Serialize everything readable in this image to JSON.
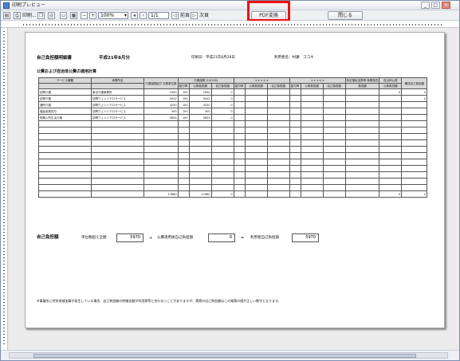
{
  "window": {
    "title": "印刷プレビュー",
    "min": "_",
    "max": "□",
    "close": "×"
  },
  "toolbar": {
    "print_label": "印刷...",
    "zoom_value": "100%",
    "page_value": "1/1",
    "prev_label": "前頁",
    "next_label": "次頁",
    "pdf_button": "PDF変換",
    "close_button": "閉じる"
  },
  "document": {
    "title": "自己負担額明細書",
    "period": "平成21年8月分",
    "print_date": "印刷日：平成21年8月28日",
    "user_name": "利用者名：村瀬　ココネ",
    "section_heading": "公費および自治体公費の適用計算",
    "headers": {
      "service_type": "サービス種類",
      "provider": "事業所名",
      "unit_total": "介護保険給付 対象単位数",
      "kaigo_group": "介護保険 (10/100)",
      "star_group1": "＊＊＊＊＊",
      "star_group2": "＊＊＊＊＊",
      "sub_ratio": "給付率",
      "sub_cost": "公費負担額",
      "sub_self": "自己負担額",
      "special_group": "特定福祉加算等 事業負担",
      "special_sub": "負担額",
      "total_group": "自治体公費",
      "total_self": "公費負担額",
      "public_self": "構成自己負担額"
    },
    "rows": [
      {
        "service": "訪問介護",
        "provider": "東京介護事業所",
        "units": "1900",
        "ratio": "100",
        "cost": "1900",
        "self": "0",
        "zero1": "0",
        "zero2": "0"
      },
      {
        "service": "訪問介護",
        "provider": "訪問ウェンリアロサービス",
        "units": "5042",
        "ratio": "100",
        "cost": "5042",
        "self": "0",
        "zero1": "",
        "zero2": "0"
      },
      {
        "service": "通所介護",
        "provider": "訪問ウェンリアロサービス",
        "units": "4250",
        "ratio": "100",
        "cost": "4250",
        "self": "0",
        "zero1": "",
        "zero2": ""
      },
      {
        "service": "福祉用具貸与",
        "provider": "訪問ウェンリアロサービス",
        "units": "500",
        "ratio": "100",
        "cost": "500",
        "self": "0",
        "zero1": "",
        "zero2": ""
      },
      {
        "service": "短期入所生活介護",
        "provider": "訪問ウェンリアロサービス",
        "units": "5855",
        "ratio": "100",
        "cost": "5855",
        "self": "0",
        "zero1": "",
        "zero2": ""
      }
    ],
    "totals": {
      "units": "17660",
      "cost": "17660",
      "self": "0",
      "zero1": "0",
      "zero2": "0"
    },
    "summary": {
      "label": "自己負担額",
      "unit_label": "単位数超え全額",
      "unit_value": "5970",
      "plus": "+",
      "public_label": "公費適用後自己負担額",
      "public_value": "0",
      "equals": "=",
      "user_label": "利用者自己負担額",
      "user_value": "5970"
    },
    "footnote": "※事業所に特別地域加算が発生している場合、自己負担額の明細金額が利用票等と合わないことがありますが、実際の自己負担額はこの帳票の値が正しい数字となります。"
  }
}
